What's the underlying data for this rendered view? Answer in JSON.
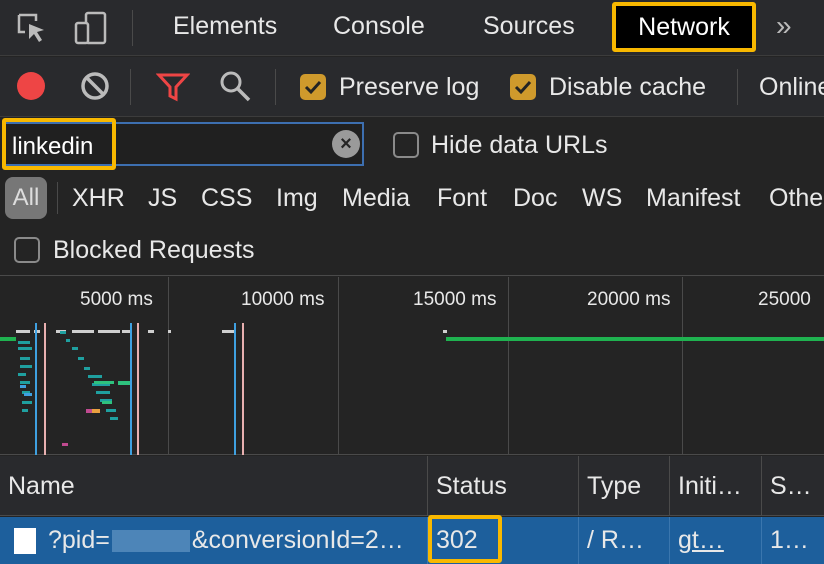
{
  "tabbar": {
    "tabs": [
      "Elements",
      "Console",
      "Sources",
      "Network"
    ],
    "active_tab": "Network",
    "more_label": "»"
  },
  "toolbar": {
    "preserve_log_label": "Preserve log",
    "preserve_log_checked": true,
    "disable_cache_label": "Disable cache",
    "disable_cache_checked": true,
    "throttle_label": "Online"
  },
  "filter": {
    "value": "linkedin",
    "hide_data_urls_label": "Hide data URLs",
    "hide_data_urls_checked": false
  },
  "type_filters": [
    "All",
    "XHR",
    "JS",
    "CSS",
    "Img",
    "Media",
    "Font",
    "Doc",
    "WS",
    "Manifest",
    "Other"
  ],
  "blocked_requests_label": "Blocked Requests",
  "blocked_requests_checked": false,
  "overview": {
    "ticks": [
      "5000 ms",
      "10000 ms",
      "15000 ms",
      "20000 ms",
      "25000"
    ]
  },
  "table": {
    "columns": [
      "Name",
      "Status",
      "Type",
      "Initi…",
      "S…"
    ],
    "rows": [
      {
        "name_prefix": "?pid=",
        "name_suffix": "&conversionId=2…",
        "status": "302",
        "type": "/ R…",
        "initiator": "gt…",
        "size": "1…"
      }
    ]
  },
  "colors": {
    "highlight": "#f8b800",
    "record": "#ee4545",
    "selected_row": "#1d5f9c",
    "checkbox": "#cf9a2c"
  }
}
